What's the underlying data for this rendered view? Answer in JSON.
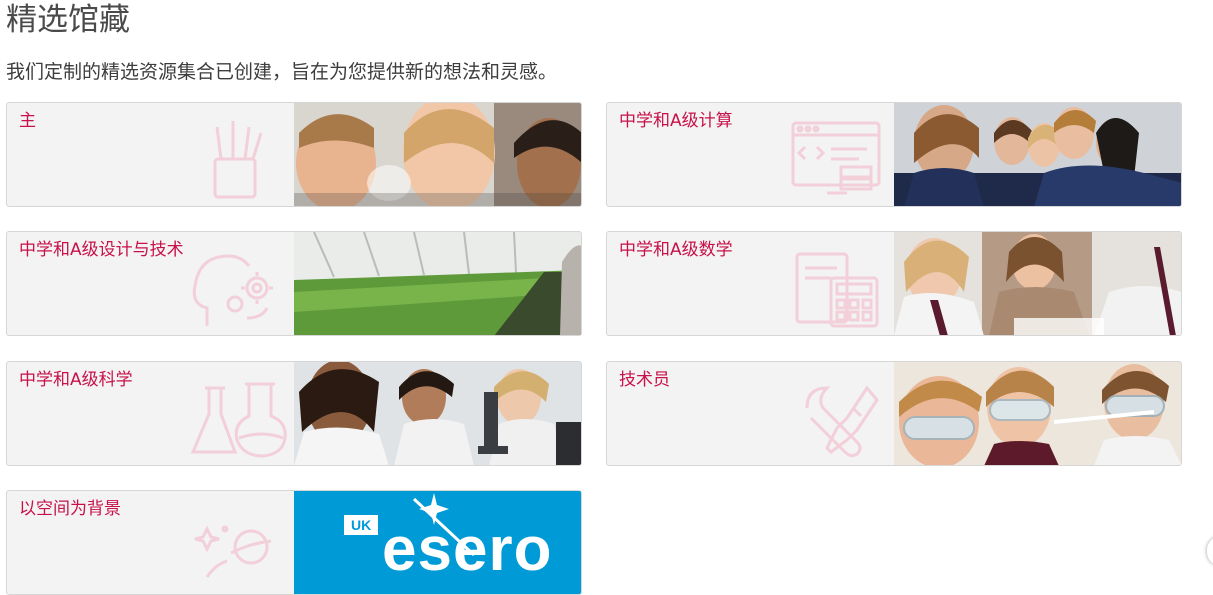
{
  "page": {
    "title": "精选馆藏",
    "subtitle": "我们定制的精选资源集合已创建，旨在为您提供新的想法和灵感。"
  },
  "collections": [
    {
      "label": "主",
      "icon": "art-supplies-icon",
      "photo": "children-experiment-photo"
    },
    {
      "label": "中学和A级计算",
      "icon": "computer-code-icon",
      "photo": "students-classroom-photo"
    },
    {
      "label": "中学和A级设计与技术",
      "icon": "head-gears-icon",
      "photo": "greenhouse-photo"
    },
    {
      "label": "中学和A级数学",
      "icon": "calculator-icon",
      "photo": "students-maths-photo"
    },
    {
      "label": "中学和A级科学",
      "icon": "lab-flasks-icon",
      "photo": "science-lab-photo"
    },
    {
      "label": "技术员",
      "icon": "tools-icon",
      "photo": "goggles-students-photo"
    },
    {
      "label": "以空间为背景",
      "icon": "space-planet-icon",
      "photo": "esero-logo"
    }
  ],
  "esero_logo": {
    "badge": "UK",
    "wordmark": "esero"
  },
  "colors": {
    "accent": "#c8104a",
    "card_bg": "#f3f3f3",
    "esero_blue": "#009ad7"
  }
}
